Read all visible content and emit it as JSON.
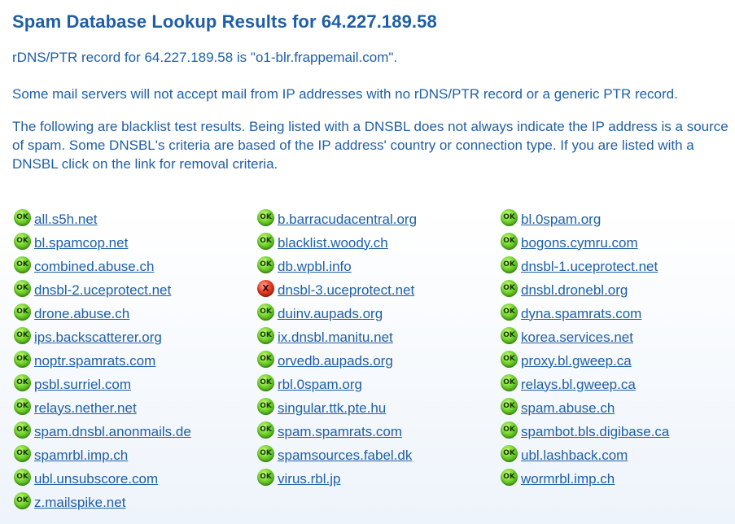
{
  "title": "Spam Database Lookup Results for 64.227.189.58",
  "rdns_text": "rDNS/PTR record for 64.227.189.58 is \"o1-blr.frappemail.com\".",
  "notice_text": "Some mail servers will not accept mail from IP addresses with no rDNS/PTR record or a generic PTR record.",
  "info_text": "The following are blacklist test results. Being listed with a DNSBL does not always indicate the IP address is a source of spam. Some DNSBL's criteria are based of the IP address' country or connection type. If you are listed with a DNSBL click on the link for removal criteria.",
  "status_labels": {
    "ok": "OK",
    "listed": "X"
  },
  "columns": [
    [
      {
        "name": "all.s5h.net",
        "status": "ok"
      },
      {
        "name": "bl.spamcop.net",
        "status": "ok"
      },
      {
        "name": "combined.abuse.ch",
        "status": "ok"
      },
      {
        "name": "dnsbl-2.uceprotect.net",
        "status": "ok"
      },
      {
        "name": "drone.abuse.ch",
        "status": "ok"
      },
      {
        "name": "ips.backscatterer.org",
        "status": "ok"
      },
      {
        "name": "noptr.spamrats.com",
        "status": "ok"
      },
      {
        "name": "psbl.surriel.com",
        "status": "ok"
      },
      {
        "name": "relays.nether.net",
        "status": "ok"
      },
      {
        "name": "spam.dnsbl.anonmails.de",
        "status": "ok"
      },
      {
        "name": "spamrbl.imp.ch",
        "status": "ok"
      },
      {
        "name": "ubl.unsubscore.com",
        "status": "ok"
      },
      {
        "name": "z.mailspike.net",
        "status": "ok"
      }
    ],
    [
      {
        "name": "b.barracudacentral.org",
        "status": "ok"
      },
      {
        "name": "blacklist.woody.ch",
        "status": "ok"
      },
      {
        "name": "db.wpbl.info",
        "status": "ok"
      },
      {
        "name": "dnsbl-3.uceprotect.net",
        "status": "listed"
      },
      {
        "name": "duinv.aupads.org",
        "status": "ok"
      },
      {
        "name": "ix.dnsbl.manitu.net",
        "status": "ok"
      },
      {
        "name": "orvedb.aupads.org",
        "status": "ok"
      },
      {
        "name": "rbl.0spam.org",
        "status": "ok"
      },
      {
        "name": "singular.ttk.pte.hu",
        "status": "ok"
      },
      {
        "name": "spam.spamrats.com",
        "status": "ok"
      },
      {
        "name": "spamsources.fabel.dk",
        "status": "ok"
      },
      {
        "name": "virus.rbl.jp",
        "status": "ok"
      }
    ],
    [
      {
        "name": "bl.0spam.org",
        "status": "ok"
      },
      {
        "name": "bogons.cymru.com",
        "status": "ok"
      },
      {
        "name": "dnsbl-1.uceprotect.net",
        "status": "ok"
      },
      {
        "name": "dnsbl.dronebl.org",
        "status": "ok"
      },
      {
        "name": "dyna.spamrats.com",
        "status": "ok"
      },
      {
        "name": "korea.services.net",
        "status": "ok"
      },
      {
        "name": "proxy.bl.gweep.ca",
        "status": "ok"
      },
      {
        "name": "relays.bl.gweep.ca",
        "status": "ok"
      },
      {
        "name": "spam.abuse.ch",
        "status": "ok"
      },
      {
        "name": "spambot.bls.digibase.ca",
        "status": "ok"
      },
      {
        "name": "ubl.lashback.com",
        "status": "ok"
      },
      {
        "name": "wormrbl.imp.ch",
        "status": "ok"
      }
    ]
  ]
}
